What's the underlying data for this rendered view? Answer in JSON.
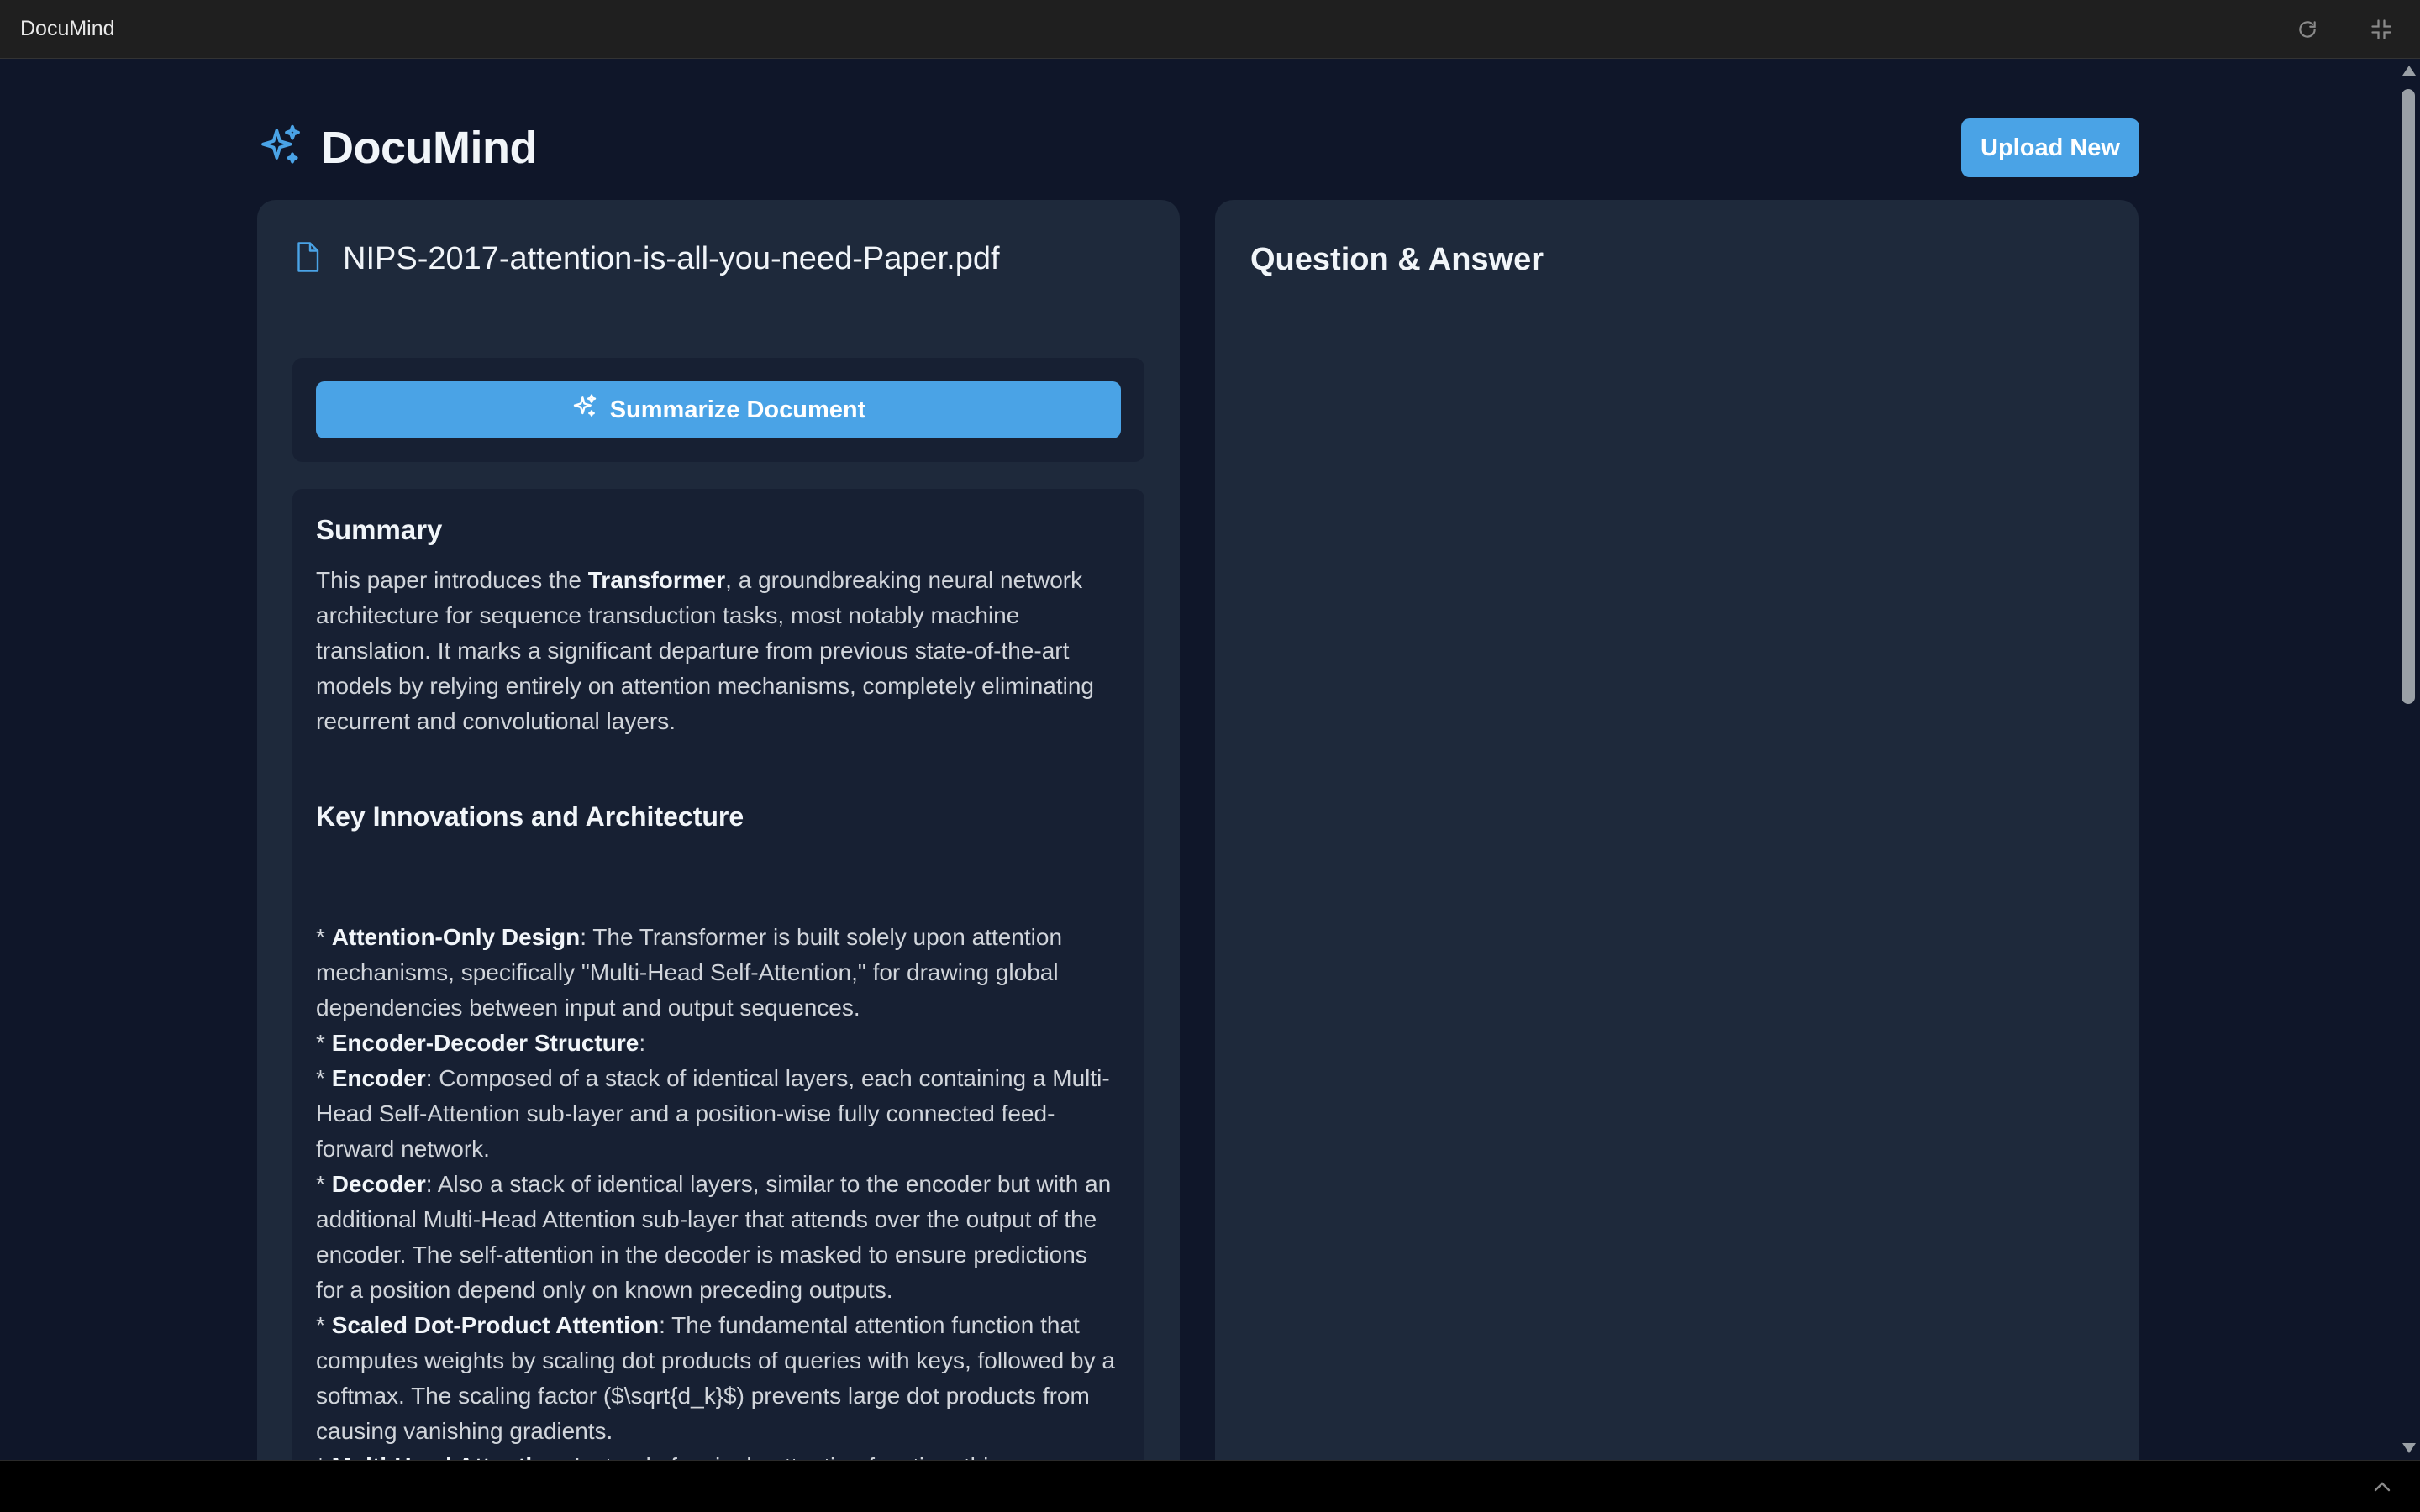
{
  "window": {
    "title": "DocuMind",
    "icons": [
      "refresh-icon",
      "minimize-window-icon"
    ]
  },
  "header": {
    "brand_name": "DocuMind",
    "brand_icon": "sparkles-icon",
    "upload_label": "Upload New"
  },
  "document": {
    "file_name": "NIPS-2017-attention-is-all-you-need-Paper.pdf",
    "summarize_label": "Summarize Document"
  },
  "summary": {
    "title": "Summary",
    "intro_before": "This paper introduces the ",
    "intro_bold": "Transformer",
    "intro_after": ", a groundbreaking neural network architecture for sequence transduction tasks, most notably machine translation. It marks a significant departure from previous state-of-the-art models by relying entirely on attention mechanisms, completely eliminating recurrent and convolutional layers.",
    "section_heading": "Key Innovations and Architecture",
    "bullets": [
      {
        "prefix": "* ",
        "bold": "Attention-Only Design",
        "text": ": The Transformer is built solely upon attention mechanisms, specifically \"Multi-Head Self-Attention,\" for drawing global dependencies between input and output sequences."
      },
      {
        "prefix": "* ",
        "bold": "Encoder-Decoder Structure",
        "text": ":"
      },
      {
        "prefix": "* ",
        "bold": "Encoder",
        "text": ": Composed of a stack of identical layers, each containing a Multi-Head Self-Attention sub-layer and a position-wise fully connected feed-forward network."
      },
      {
        "prefix": "* ",
        "bold": "Decoder",
        "text": ": Also a stack of identical layers, similar to the encoder but with an additional Multi-Head Attention sub-layer that attends over the output of the encoder. The self-attention in the decoder is masked to ensure predictions for a position depend only on known preceding outputs."
      },
      {
        "prefix": "* ",
        "bold": "Scaled Dot-Product Attention",
        "text": ": The fundamental attention function that computes weights by scaling dot products of queries with keys, followed by a softmax. The scaling factor ($\\sqrt{d_k}$) prevents large dot products from causing vanishing gradients."
      },
      {
        "prefix": "* ",
        "bold": "Multi-Head Attention",
        "text": ": Instead of a single attention function, this mechanism performs multiple attention calculations in parallel with different"
      }
    ]
  },
  "qa": {
    "title": "Question & Answer"
  },
  "colors": {
    "background": "#0f1629",
    "card": "#1e293b",
    "panel": "#172033",
    "accent": "#4aa3e6"
  }
}
